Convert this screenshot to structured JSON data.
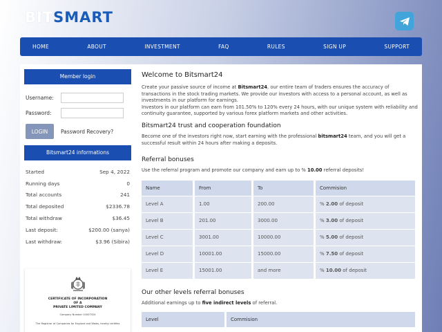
{
  "brand": {
    "part1": "BIT",
    "part2": "SMART"
  },
  "nav": [
    "HOME",
    "ABOUT",
    "INVESTMENT",
    "FAQ",
    "RULES",
    "SIGN UP",
    "SUPPORT"
  ],
  "login": {
    "title": "Member login",
    "username_label": "Username:",
    "password_label": "Password:",
    "button": "LOGIN",
    "recovery": "Password Recovery?"
  },
  "info": {
    "title": "Bitsmart24 informations",
    "rows": [
      {
        "label": "Started",
        "value": "Sep 4, 2022"
      },
      {
        "label": "Running days",
        "value": "0"
      },
      {
        "label": "Total accounts",
        "value": "241"
      },
      {
        "label": "Total deposited",
        "value": "$2336.78"
      },
      {
        "label": "Total withdraw",
        "value": "$36.45"
      },
      {
        "label": "Last deposit:",
        "value": "$200.00 (sanya)"
      },
      {
        "label": "Last withdraw:",
        "value": "$3.96 (Sibira)"
      }
    ]
  },
  "certificate": {
    "line1": "CERTIFICATE OF INCORPORATION",
    "line2": "OF A",
    "line3": "PRIVATE LIMITED COMPANY",
    "company_number": "Company Number 10007524",
    "footer": "The Registrar of Companies for England and Wales, hereby certifies"
  },
  "main": {
    "welcome_title": "Welcome to Bitsmart24",
    "p1_a": "Create your passive source of income at ",
    "p1_b": "Bitsmart24",
    "p1_c": ", our entire team of traders ensures the accuracy of transactions in the stock trading markets. We provide our investors with access to a personal account, as well as investments in our platform for earnings.",
    "p2": "Investors in our platform can earn from 101.50% to 120% every 24 hours, with our unique system with reliability and continuity guarantee, supported by various forex platform markets and other activities.",
    "trust_title": "Bitsmart24 trust and cooperation foundation",
    "p3_a": "Become one of the investors right now, start earning with the professional ",
    "p3_b": "bitsmart24",
    "p3_c": " team, and you will get a successful result within 24 hours after making a deposits.",
    "ref_title": "Referral bonuses",
    "p4_a": "Use the referral program and promote our company and earn up to % ",
    "p4_b": "10.00",
    "p4_c": " referral deposits!",
    "ref_table": {
      "headers": [
        "Name",
        "From",
        "To",
        "Commision"
      ],
      "rows": [
        {
          "name": "Level A",
          "from": "1.00",
          "to": "200.00",
          "pct": "2.00"
        },
        {
          "name": "Level B",
          "from": "201.00",
          "to": "3000.00",
          "pct": "3.00"
        },
        {
          "name": "Level C",
          "from": "3001.00",
          "to": "10000.00",
          "pct": "5.00"
        },
        {
          "name": "Level D",
          "from": "10001.00",
          "to": "15000.00",
          "pct": "7.50"
        },
        {
          "name": "Level E",
          "from": "15001.00",
          "to": "and more",
          "pct": "10.00"
        }
      ],
      "pct_prefix": "% ",
      "pct_suffix": " of deposit"
    },
    "other_title": "Our other levels referral bonuses",
    "p5_a": "Additional earnings up to ",
    "p5_b": "five indirect levels",
    "p5_c": " of referral.",
    "other_table_headers": [
      "Level",
      "Commision"
    ]
  },
  "colors": {
    "primary": "#1a4eb0",
    "telegram": "#41a5db",
    "button": "#8496ba"
  },
  "icons": {
    "telegram": "telegram-icon",
    "crest": "royal-crest-icon"
  }
}
